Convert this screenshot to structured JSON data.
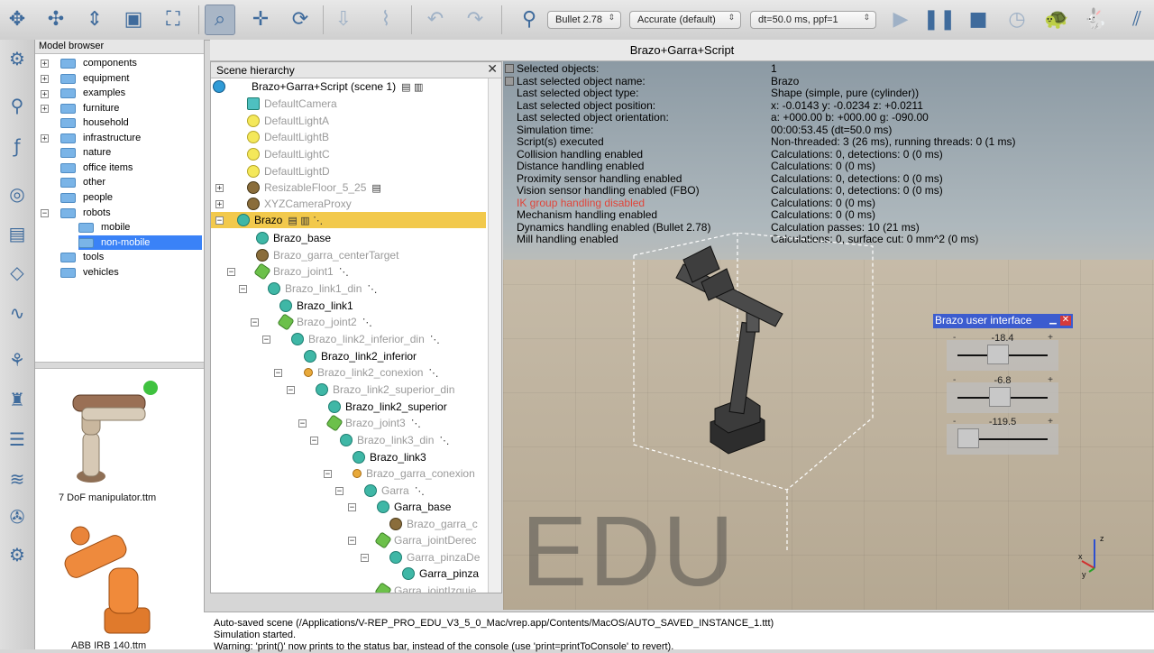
{
  "toolbar": {
    "engine": "Bullet 2.78",
    "accuracy": "Accurate (default)",
    "timestep": "dt=50.0 ms, ppf=1"
  },
  "model_browser": {
    "title": "Model browser",
    "items": [
      {
        "label": "components"
      },
      {
        "label": "equipment"
      },
      {
        "label": "examples"
      },
      {
        "label": "furniture"
      },
      {
        "label": "household"
      },
      {
        "label": "infrastructure"
      },
      {
        "label": "nature"
      },
      {
        "label": "office items"
      },
      {
        "label": "other"
      },
      {
        "label": "people"
      },
      {
        "label": "robots"
      },
      {
        "label": "mobile"
      },
      {
        "label": "non-mobile"
      },
      {
        "label": "tools"
      },
      {
        "label": "vehicles"
      }
    ],
    "thumbnails": [
      {
        "label": "7 DoF manipulator.ttm"
      },
      {
        "label": "ABB IRB 140.ttm"
      }
    ]
  },
  "scene_hierarchy": {
    "title": "Scene hierarchy",
    "scene": "Brazo+Garra+Script (scene 1)",
    "rows": [
      {
        "label": "DefaultCamera"
      },
      {
        "label": "DefaultLightA"
      },
      {
        "label": "DefaultLightB"
      },
      {
        "label": "DefaultLightC"
      },
      {
        "label": "DefaultLightD"
      },
      {
        "label": "ResizableFloor_5_25"
      },
      {
        "label": "XYZCameraProxy"
      },
      {
        "label": "Brazo"
      },
      {
        "label": "Brazo_base"
      },
      {
        "label": "Brazo_garra_centerTarget"
      },
      {
        "label": "Brazo_joint1"
      },
      {
        "label": "Brazo_link1_din"
      },
      {
        "label": "Brazo_link1"
      },
      {
        "label": "Brazo_joint2"
      },
      {
        "label": "Brazo_link2_inferior_din"
      },
      {
        "label": "Brazo_link2_inferior"
      },
      {
        "label": "Brazo_link2_conexion"
      },
      {
        "label": "Brazo_link2_superior_din"
      },
      {
        "label": "Brazo_link2_superior"
      },
      {
        "label": "Brazo_joint3"
      },
      {
        "label": "Brazo_link3_din"
      },
      {
        "label": "Brazo_link3"
      },
      {
        "label": "Brazo_garra_conexion"
      },
      {
        "label": "Garra"
      },
      {
        "label": "Garra_base"
      },
      {
        "label": "Brazo_garra_c"
      },
      {
        "label": "Garra_jointDerec"
      },
      {
        "label": "Garra_pinzaDe"
      },
      {
        "label": "Garra_pinza"
      },
      {
        "label": "Garra_jointIzquie"
      }
    ]
  },
  "viewport": {
    "title": "Brazo+Garra+Script",
    "info": [
      {
        "label": "Selected objects:",
        "value": "1"
      },
      {
        "label": "Last selected object name:",
        "value": "Brazo"
      },
      {
        "label": "Last selected object type:",
        "value": "Shape (simple, pure (cylinder))"
      },
      {
        "label": "Last selected object position:",
        "value": "x: -0.0143    y: -0.0234    z: +0.0211"
      },
      {
        "label": "Last selected object orientation:",
        "value": "a: +000.00    b: +000.00    g: -090.00"
      },
      {
        "label": "Simulation time:",
        "value": "00:00:53.45 (dt=50.0 ms)"
      },
      {
        "label": "Script(s) executed",
        "value": "Non-threaded: 3 (26 ms), running threads: 0 (1 ms)"
      },
      {
        "label": "Collision handling enabled",
        "value": "Calculations: 0, detections: 0 (0 ms)"
      },
      {
        "label": "Distance handling enabled",
        "value": "Calculations: 0 (0 ms)"
      },
      {
        "label": "Proximity sensor handling enabled",
        "value": "Calculations: 0, detections: 0 (0 ms)"
      },
      {
        "label": "Vision sensor handling enabled (FBO)",
        "value": "Calculations: 0, detections: 0 (0 ms)"
      },
      {
        "label": "IK group handling disabled",
        "value": "Calculations: 0 (0 ms)"
      },
      {
        "label": "Mechanism handling enabled",
        "value": "Calculations: 0 (0 ms)"
      },
      {
        "label": "Dynamics handling enabled (Bullet 2.78)",
        "value": "Calculation passes: 10 (21 ms)"
      },
      {
        "label": "Mill handling enabled",
        "value": "Calculations: 0, surface cut: 0 mm^2 (0 ms)"
      }
    ],
    "watermark": "EDU",
    "axis_labels": {
      "z": "z",
      "x": "x",
      "y": "y"
    }
  },
  "ui_dialog": {
    "title": "Brazo user interface",
    "min_label": "-",
    "max_label": "+",
    "sliders": [
      {
        "value": "-18.4",
        "fraction": 0.45
      },
      {
        "value": "-6.8",
        "fraction": 0.47
      },
      {
        "value": "-119.5",
        "fraction": 0.12
      }
    ]
  },
  "console": {
    "lines": [
      "Auto-saved scene (/Applications/V-REP_PRO_EDU_V3_5_0_Mac/vrep.app/Contents/MacOS/AUTO_SAVED_INSTANCE_1.ttt)",
      "Simulation started.",
      "Warning: 'print()' now prints to the status bar, instead of the console (use 'print=printToConsole' to revert)."
    ]
  }
}
